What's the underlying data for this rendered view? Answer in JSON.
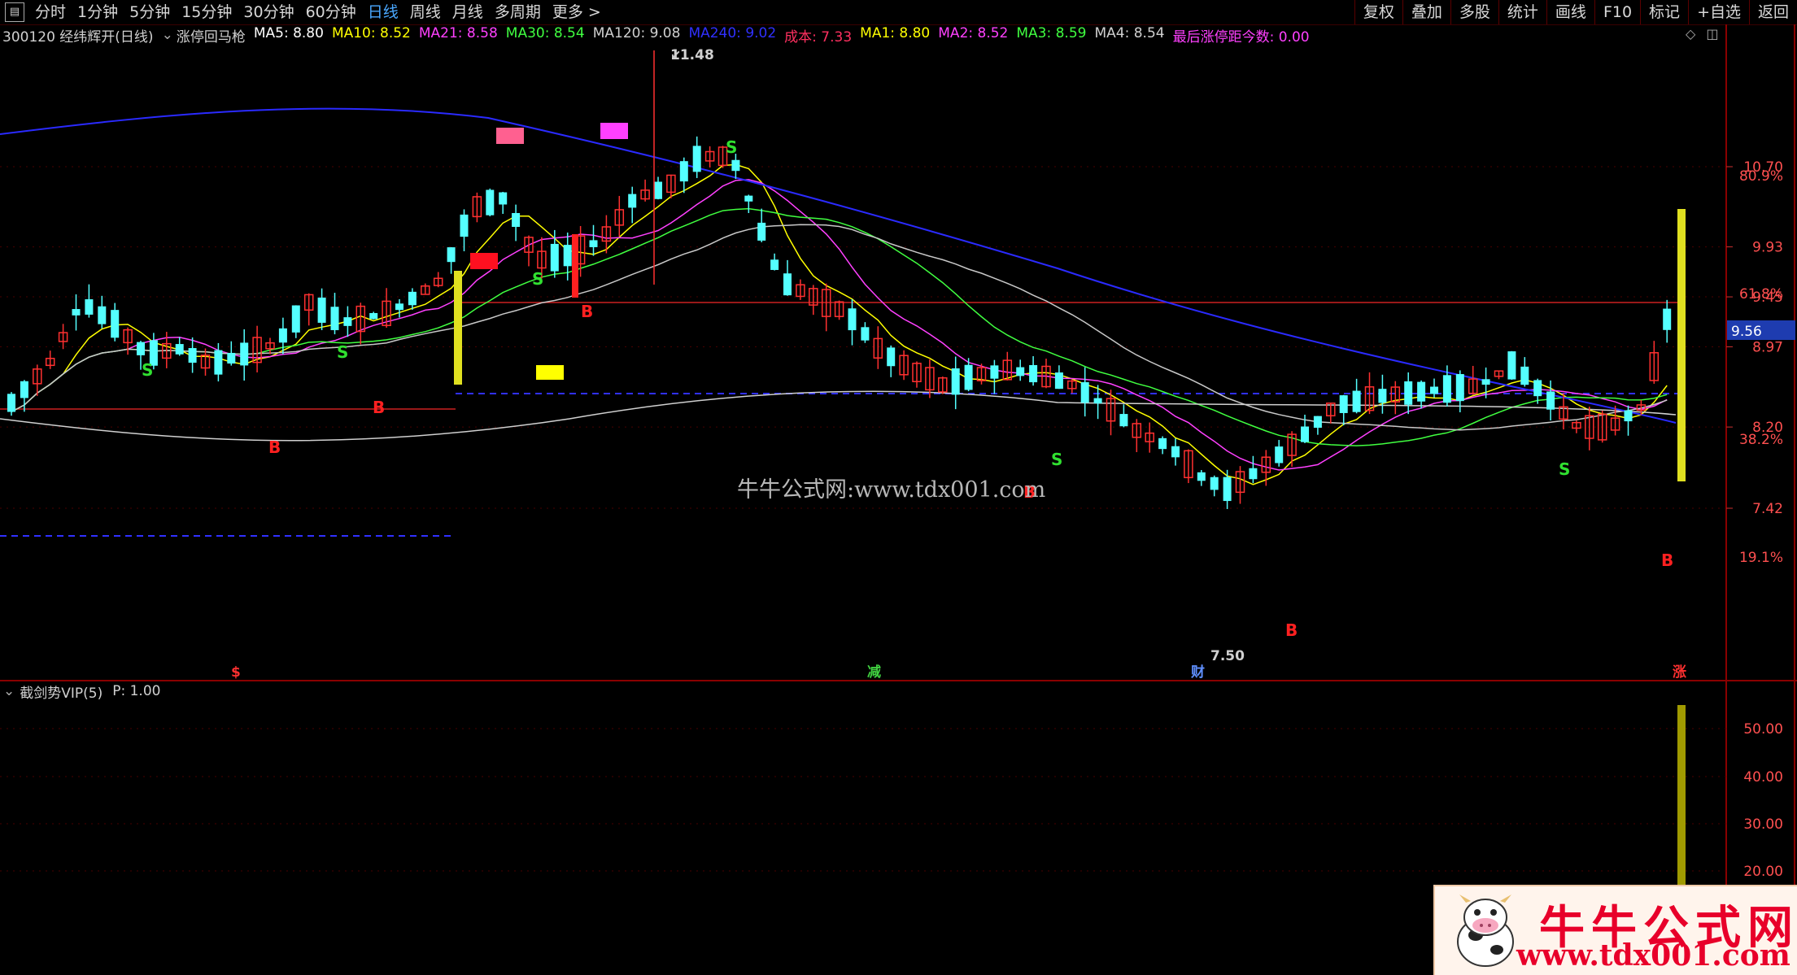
{
  "toolbar": {
    "menu_icon": "menu-icon",
    "periods": [
      "分时",
      "1分钟",
      "5分钟",
      "15分钟",
      "30分钟",
      "60分钟",
      "日线",
      "周线",
      "月线",
      "多周期",
      "更多 >"
    ],
    "active_index": 6,
    "actions": [
      "复权",
      "叠加",
      "多股",
      "统计",
      "画线",
      "F10",
      "标记",
      "+自选",
      "返回"
    ]
  },
  "stock": {
    "code_name": "300120 经纬辉开(日线)",
    "indicator_name": "涨停回马枪"
  },
  "ma_legend": [
    {
      "label": "MA5: 8.80",
      "color": "#ffffff"
    },
    {
      "label": "MA10: 8.52",
      "color": "#ffff00"
    },
    {
      "label": "MA21: 8.58",
      "color": "#ff40ff"
    },
    {
      "label": "MA30: 8.54",
      "color": "#40ff40"
    },
    {
      "label": "MA120: 9.08",
      "color": "#d0d0d0"
    },
    {
      "label": "MA240: 9.02",
      "color": "#3030ff"
    },
    {
      "label": "成本: 7.33",
      "color": "#ff3060"
    },
    {
      "label": "MA1: 8.80",
      "color": "#ffff00"
    },
    {
      "label": "MA2: 8.52",
      "color": "#ff40ff"
    },
    {
      "label": "MA3: 8.59",
      "color": "#40ff40"
    },
    {
      "label": "MA4: 8.54",
      "color": "#d0d0d0"
    },
    {
      "label": "最后涨停距今数: 0.00",
      "color": "#ff40ff"
    }
  ],
  "price_axis": {
    "ticks": [
      "10.70",
      "9.93",
      "9.45",
      "8.97",
      "8.20",
      "7.42"
    ],
    "percent_ticks": [
      "80.9%",
      "61.8%",
      "38.2%",
      "19.1%"
    ],
    "current_price": "9.56"
  },
  "annotations": {
    "high_price": "11.48",
    "low_price": "7.50",
    "watermark": "牛牛公式网:www.tdx001.com",
    "bottom_markers": [
      "$",
      "减",
      "财",
      "涨"
    ],
    "signals_buy": "B",
    "signals_sell": "S"
  },
  "sub_indicator": {
    "name": "截剑势VIP(5)",
    "param": "P: 1.00",
    "ticks": [
      "50.00",
      "40.00",
      "30.00",
      "20.00"
    ]
  },
  "logo": {
    "title": "牛牛公式网",
    "url": "www.tdx001.com"
  },
  "colors": {
    "up_candle": "#ff3030",
    "down_candle": "#54ffff",
    "background": "#000000",
    "axis_border": "#8a0000"
  }
}
